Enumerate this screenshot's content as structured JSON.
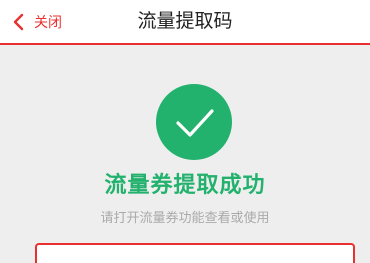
{
  "nav": {
    "back_label": "关闭",
    "title": "流量提取码",
    "accent_color": "#e8312f"
  },
  "icons": {
    "back": "chevron-left-icon",
    "success": "check-circle-icon"
  },
  "result": {
    "title": "流量券提取成功",
    "hint": "请打开流量券功能查看或使用",
    "success_color": "#23b26d"
  }
}
